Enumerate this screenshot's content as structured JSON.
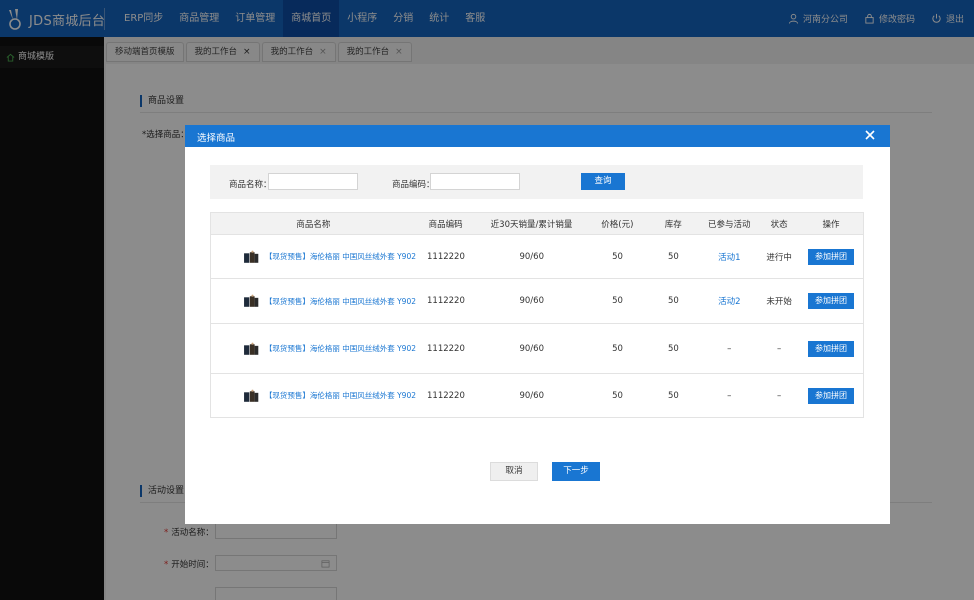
{
  "app": {
    "title": "JDS商城后台"
  },
  "nav": {
    "items": [
      "ERP同步",
      "商品管理",
      "订单管理",
      "商城首页",
      "小程序",
      "分销",
      "统计",
      "客服"
    ],
    "active_index": 3,
    "user": "河南分公司",
    "change_password": "修改密码",
    "logout": "退出"
  },
  "sidebar": {
    "items": [
      {
        "label": "商城模版",
        "icon": "home-icon"
      }
    ]
  },
  "tabs": [
    {
      "label": "移动端首页模版",
      "closable": false
    },
    {
      "label": "我的工作台",
      "closable": true
    },
    {
      "label": "我的工作台",
      "closable": true
    },
    {
      "label": "我的工作台",
      "closable": true
    }
  ],
  "background": {
    "section1": "商品设置",
    "select_product_label": "*选择商品：",
    "section2": "活动设置",
    "activity_name_label": "活动名称：",
    "start_time_label": "开始时间："
  },
  "modal": {
    "title": "选择商品",
    "search": {
      "name_label": "商品名称：",
      "name_value": "",
      "code_label": "商品编码：",
      "code_value": "",
      "query_button": "查询"
    },
    "table": {
      "headers": [
        "商品名称",
        "商品编码",
        "近30天销量/累计销量",
        "价格(元)",
        "库存",
        "已参与活动",
        "状态",
        "操作"
      ],
      "rows": [
        {
          "name": "【现货预售】海伦格丽 中国风丝绒外套 Y902",
          "code": "1112220",
          "sales": "90/60",
          "price": "50",
          "stock": "50",
          "activity": "活动1",
          "status": "进行中",
          "action": "参加拼团"
        },
        {
          "name": "【现货预售】海伦格丽 中国风丝绒外套 Y902",
          "code": "1112220",
          "sales": "90/60",
          "price": "50",
          "stock": "50",
          "activity": "活动2",
          "status": "未开始",
          "action": "参加拼团"
        },
        {
          "name": "【现货预售】海伦格丽 中国风丝绒外套 Y902",
          "code": "1112220",
          "sales": "90/60",
          "price": "50",
          "stock": "50",
          "activity": "–",
          "status": "–",
          "action": "参加拼团"
        },
        {
          "name": "【现货预售】海伦格丽 中国风丝绒外套 Y902",
          "code": "1112220",
          "sales": "90/60",
          "price": "50",
          "stock": "50",
          "activity": "–",
          "status": "–",
          "action": "参加拼团"
        }
      ]
    },
    "cancel_button": "取消",
    "next_button": "下一步"
  },
  "colors": {
    "primary": "#1976d2",
    "nav_bg": "#1565c0",
    "sidebar_bg": "#111111"
  }
}
